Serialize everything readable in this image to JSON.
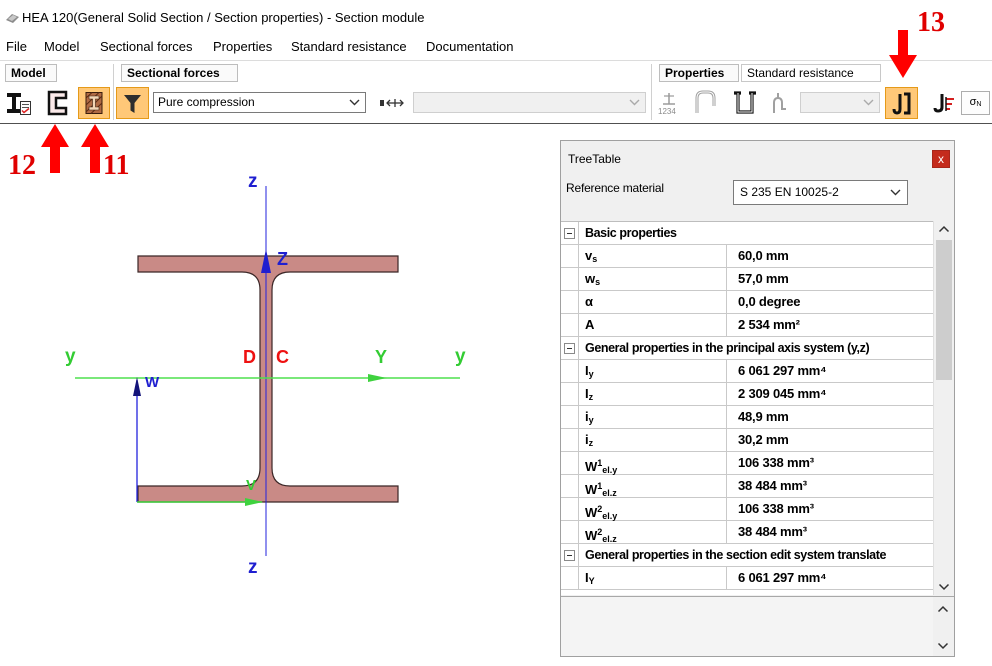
{
  "window": {
    "title": "HEA 120(General Solid Section / Section properties) - Section module",
    "icon": "section-module-icon"
  },
  "menu": {
    "items": [
      "File",
      "Model",
      "Sectional forces",
      "Properties",
      "Standard resistance",
      "Documentation"
    ]
  },
  "toolbar": {
    "groups": {
      "model": "Model",
      "sectional_forces": "Sectional forces",
      "properties": "Properties",
      "standard_resistance": "Standard resistance"
    },
    "load_case": "Pure compression",
    "sort_icon_text": "1234",
    "sigma_symbol": "σ",
    "sigma_sub": "N",
    "icons": [
      {
        "name": "i-section-check-icon",
        "active": false
      },
      {
        "name": "c-section-icon",
        "active": false
      },
      {
        "name": "section-properties-icon",
        "active": true
      },
      {
        "name": "filter-icon",
        "active": true
      },
      {
        "name": "transfer-arrows-icon",
        "active": false
      },
      {
        "name": "numbering-icon",
        "active": false
      },
      {
        "name": "arch-icon",
        "active": false
      },
      {
        "name": "profile-outline-icon",
        "active": false
      },
      {
        "name": "profile-thin-icon",
        "active": false
      },
      {
        "name": "stress-distribution-icon",
        "active": true
      },
      {
        "name": "stress-point-icon",
        "active": false
      }
    ]
  },
  "annotations": {
    "label_12": "12",
    "label_11": "11",
    "label_13": "13"
  },
  "drawing": {
    "z_top": "z",
    "z_bottom": "z",
    "z_principal": "Z",
    "y_left": "y",
    "y_principal": "Y",
    "y_right": "y",
    "point_d": "D",
    "point_c": "C",
    "axis_w": "W",
    "axis_v": "V"
  },
  "colors": {
    "highlight_bg": "#ffc878",
    "highlight_border": "#e59a19",
    "section_fill": "#c98a86",
    "axis_blue": "#2222dd",
    "axis_green": "#3fd23f",
    "label_red": "#ee1111",
    "annotation_red": "#ff0000",
    "close_button": "#c42b1c"
  },
  "treetable": {
    "title": "TreeTable",
    "close": "x",
    "reference_label": "Reference material",
    "reference_value": "S 235 EN 10025-2",
    "rows": [
      {
        "group": "Basic properties"
      },
      {
        "sym": "v",
        "sub": "s",
        "value": "60,0 mm"
      },
      {
        "sym": "w",
        "sub": "s",
        "value": "57,0 mm"
      },
      {
        "sym": "α",
        "value": "0,0 degree"
      },
      {
        "sym": "A",
        "value": "2 534 mm²"
      },
      {
        "group": "General properties in the principal axis system (y,z)"
      },
      {
        "sym": "I",
        "sub": "y",
        "value": "6 061 297 mm⁴"
      },
      {
        "sym": "I",
        "sub": "z",
        "value": "2 309 045 mm⁴"
      },
      {
        "sym": "i",
        "sub": "y",
        "value": "48,9 mm"
      },
      {
        "sym": "i",
        "sub": "z",
        "value": "30,2 mm"
      },
      {
        "sym": "W",
        "sup": "1",
        "sub": "el.y",
        "value": "106 338 mm³"
      },
      {
        "sym": "W",
        "sup": "1",
        "sub": "el.z",
        "value": "38 484 mm³"
      },
      {
        "sym": "W",
        "sup": "2",
        "sub": "el.y",
        "value": "106 338 mm³"
      },
      {
        "sym": "W",
        "sup": "2",
        "sub": "el.z",
        "value": "38 484 mm³"
      },
      {
        "group": "General properties in the section edit system translate"
      },
      {
        "sym": "I",
        "sub": "Y",
        "value": "6 061 297 mm⁴"
      }
    ]
  }
}
